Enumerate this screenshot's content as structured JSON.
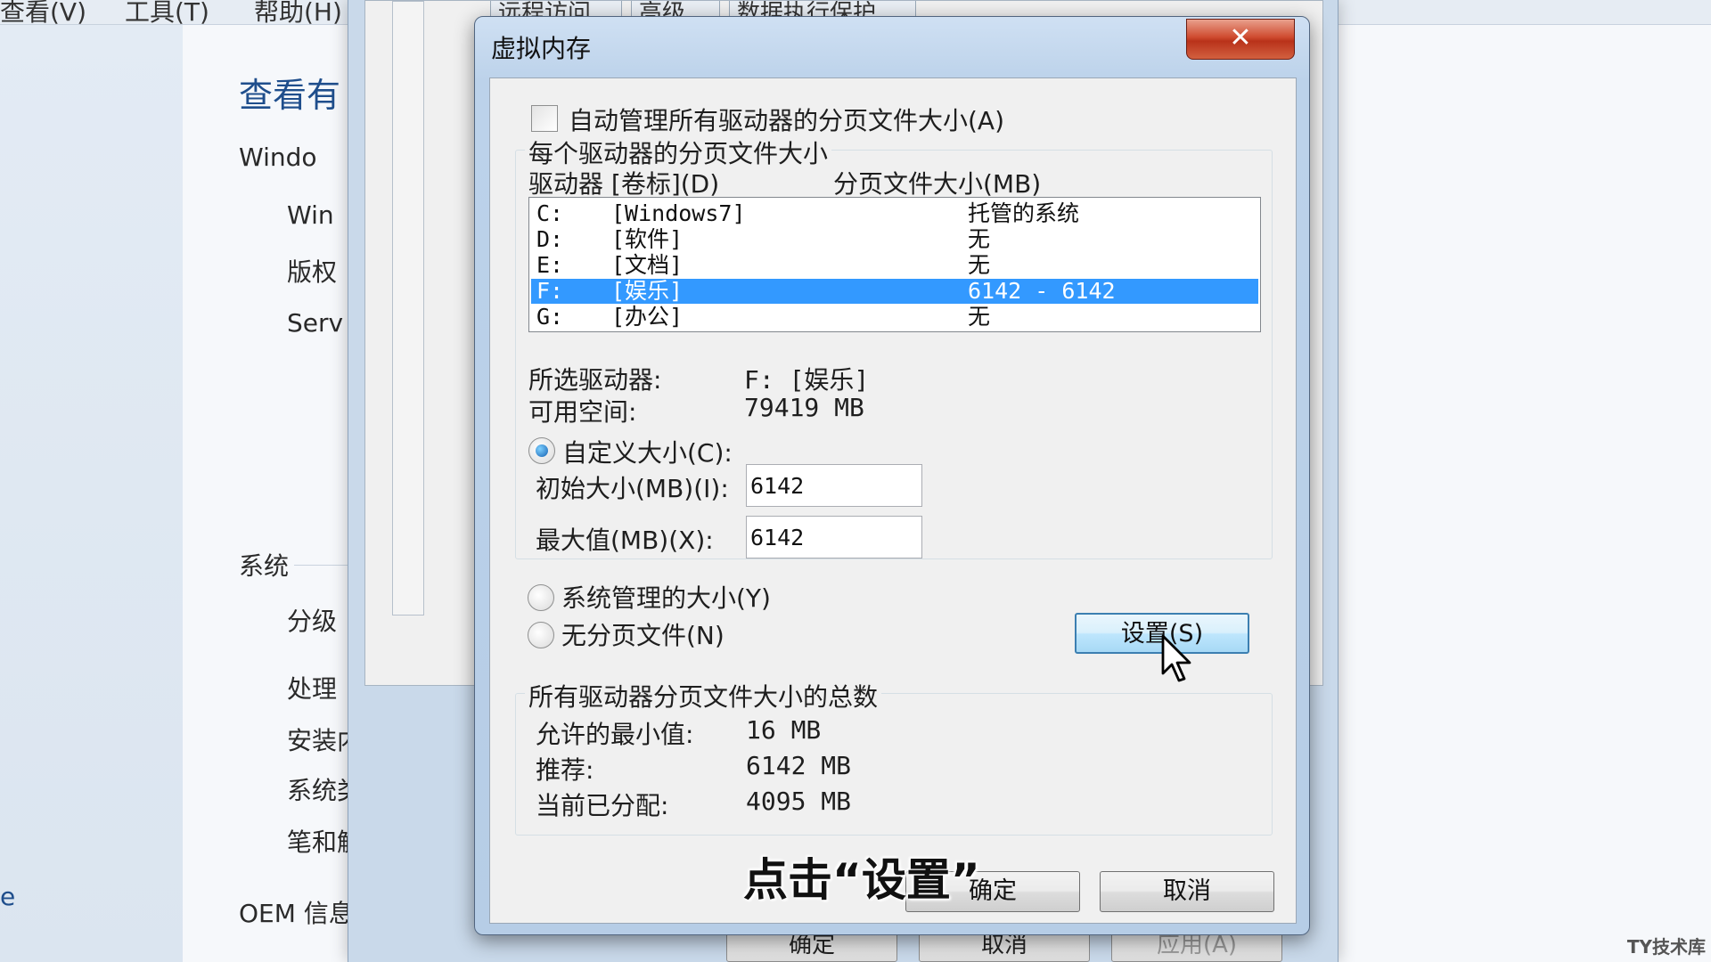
{
  "background": {
    "menu": [
      "查看(V)",
      "工具(T)",
      "帮助(H)"
    ],
    "heading": "查看有",
    "windows_label": "Windo",
    "items": [
      "Win",
      "版权",
      "Serv"
    ],
    "system_section": "系统",
    "system_items": [
      "分级",
      "处理",
      "安装内存(R",
      "系统类型:",
      "笔和触摸:"
    ],
    "oem_section": "OEM 信息",
    "edge_text": "e",
    "sysprops_tabs": [
      "远程访问",
      "高级",
      "数据执行保护"
    ],
    "sysprops_buttons": {
      "ok": "确定",
      "cancel": "取消",
      "apply": "应用(A)"
    }
  },
  "dialog": {
    "title": "虚拟内存",
    "close_glyph": "✕",
    "auto_manage_label": "自动管理所有驱动器的分页文件大小(A)",
    "auto_manage_checked": false,
    "per_drive_title": "每个驱动器的分页文件大小",
    "columns": {
      "drive": "驱动器 [卷标](D)",
      "size": "分页文件大小(MB)"
    },
    "drives": [
      {
        "letter": "C:",
        "label": "[Windows7]",
        "size": "托管的系统",
        "selected": false
      },
      {
        "letter": "D:",
        "label": "[软件]",
        "size": "无",
        "selected": false
      },
      {
        "letter": "E:",
        "label": "[文档]",
        "size": "无",
        "selected": false
      },
      {
        "letter": "F:",
        "label": "[娱乐]",
        "size": "6142 - 6142",
        "selected": true
      },
      {
        "letter": "G:",
        "label": "[办公]",
        "size": "无",
        "selected": false
      }
    ],
    "selected_drive_label": "所选驱动器:",
    "selected_drive_value": "F:  [娱乐]",
    "free_space_label": "可用空间:",
    "free_space_value": "79419 MB",
    "custom_size_label": "自定义大小(C):",
    "initial_size_label": "初始大小(MB)(I):",
    "initial_size_value": "6142",
    "max_size_label": "最大值(MB)(X):",
    "max_size_value": "6142",
    "system_managed_label": "系统管理的大小(Y)",
    "no_paging_label": "无分页文件(N)",
    "selected_option": "custom",
    "set_button": "设置(S)",
    "total_title": "所有驱动器分页文件大小的总数",
    "min_allowed_label": "允许的最小值:",
    "min_allowed_value": "16 MB",
    "recommended_label": "推荐:",
    "recommended_value": "6142 MB",
    "allocated_label": "当前已分配:",
    "allocated_value": "4095 MB",
    "ok_button": "确定",
    "cancel_button": "取消"
  },
  "overlay": {
    "subtitle": "点击“设置”",
    "watermark": "TY技术库"
  },
  "colors": {
    "selection": "#3399ff",
    "close_button": "#cf4b2f",
    "frame": "#b6cde6"
  }
}
